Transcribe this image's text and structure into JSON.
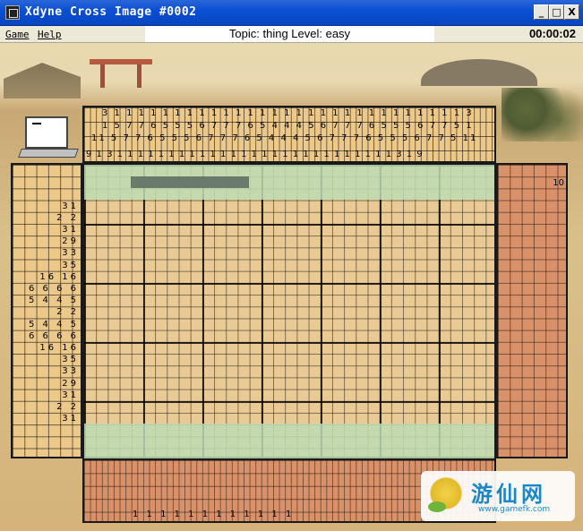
{
  "window": {
    "title": "Xdyne Cross Image #0002",
    "minimize_label": "_",
    "maximize_label": "□",
    "close_label": "X"
  },
  "menu": {
    "items": [
      {
        "label": "Game"
      },
      {
        "label": "Help"
      }
    ]
  },
  "status": {
    "topic_level": "Topic: thing   Level: easy",
    "timer": "00:00:02"
  },
  "puzzle": {
    "left_clues": [
      "",
      "",
      "",
      "31",
      "2 2",
      "31",
      "29",
      "33",
      "35",
      "16 16",
      "6 6 6 6",
      "5 4 4 5",
      "2 2",
      "5 4 4 5",
      "6 6 6 6",
      "16 16",
      "35",
      "33",
      "29",
      "31",
      "2 2",
      "31"
    ],
    "top_clue_rows": [
      "3 1 1 1 1 1 1 1 1 1 1 1 1 1 1 1 1 1 1 1 1 1 1 1 1 1 1 1 1 1 3",
      "1 5 7 7 6 5 5 5 6 7 7 7 6 5 4 4 4 5 6 7 7 7 6 5 5 5 6 7 7 5 1",
      "11 5 7 7 6 5 5 5 6 7 7 7 6 5 4 4 4 5 6 7 7 7 6 5 5 5 6 7 7 5 11",
      "9 1 3 1 1 1 1 1 1 1 1 1 1 1 1 1 1 1 1 1 1 1 1 1 1 1 1 1 1 1 3 1 9"
    ],
    "right_clue": "10",
    "bottom_clue_row": "1 1 1 1 1 1 1 1 1 1 1 1"
  },
  "watermark": {
    "text": "游仙网",
    "url": "www.gamefk.com"
  }
}
